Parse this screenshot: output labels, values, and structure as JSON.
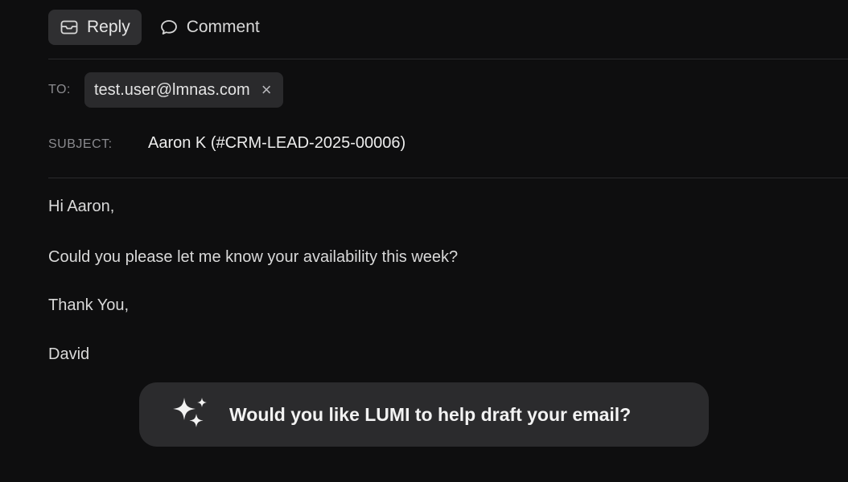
{
  "tabs": [
    {
      "label": "Reply",
      "icon": "envelope-icon",
      "active": true
    },
    {
      "label": "Comment",
      "icon": "speech-bubble-icon",
      "active": false
    }
  ],
  "compose": {
    "to_label": "TO:",
    "recipients": [
      {
        "email": "test.user@lmnas.com",
        "remove_icon": "close-icon"
      }
    ],
    "subject_label": "SUBJECT:",
    "subject": "Aaron K (#CRM-LEAD-2025-00006)"
  },
  "body": {
    "lines": [
      "Hi Aaron,",
      "Could you please let me know your availability this week?",
      "Thank You,",
      "David"
    ]
  },
  "assistant": {
    "icon": "sparkle-icon",
    "prompt": "Would you like LUMI to help draft your email?"
  },
  "colors": {
    "background": "#0e0e0f",
    "chip": "#2a2a2c",
    "prompt_bg": "#2b2b2d"
  }
}
